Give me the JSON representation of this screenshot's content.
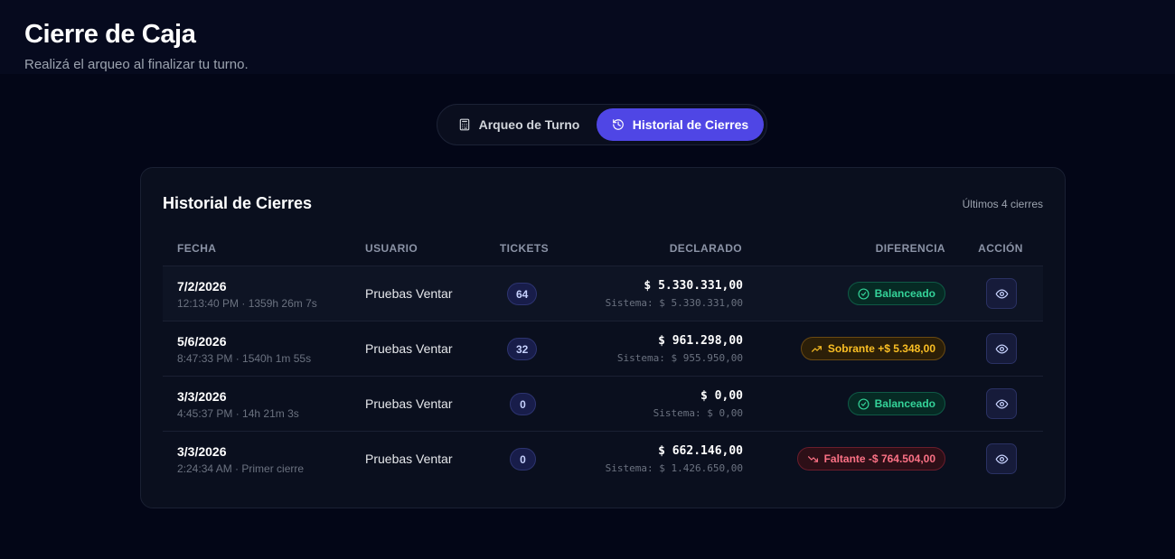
{
  "header": {
    "title": "Cierre de Caja",
    "subtitle": "Realizá el arqueo al finalizar tu turno."
  },
  "tabs": [
    {
      "label": "Arqueo de Turno",
      "icon": "calculator-icon",
      "active": false
    },
    {
      "label": "Historial de Cierres",
      "icon": "history-icon",
      "active": true
    }
  ],
  "card": {
    "title": "Historial de Cierres",
    "meta": "Últimos 4 cierres",
    "columns": {
      "fecha": "FECHA",
      "usuario": "USUARIO",
      "tickets": "TICKETS",
      "declarado": "DECLARADO",
      "diferencia": "DIFERENCIA",
      "accion": "ACCIÓN"
    },
    "rows": [
      {
        "date": "7/2/2026",
        "sub": "12:13:40 PM · 1359h 26m 7s",
        "user": "Pruebas Ventar",
        "tickets": "64",
        "declared": "$ 5.330.331,00",
        "system": "Sistema: $ 5.330.331,00",
        "diff": "Balanceado",
        "diff_type": "ok"
      },
      {
        "date": "5/6/2026",
        "sub": "8:47:33 PM · 1540h 1m 55s",
        "user": "Pruebas Ventar",
        "tickets": "32",
        "declared": "$ 961.298,00",
        "system": "Sistema: $ 955.950,00",
        "diff": "Sobrante +$ 5.348,00",
        "diff_type": "plus"
      },
      {
        "date": "3/3/2026",
        "sub": "4:45:37 PM · 14h 21m 3s",
        "user": "Pruebas Ventar",
        "tickets": "0",
        "declared": "$ 0,00",
        "system": "Sistema: $ 0,00",
        "diff": "Balanceado",
        "diff_type": "ok"
      },
      {
        "date": "3/3/2026",
        "sub": "2:24:34 AM · Primer cierre",
        "user": "Pruebas Ventar",
        "tickets": "0",
        "declared": "$ 662.146,00",
        "system": "Sistema: $ 1.426.650,00",
        "diff": "Faltante -$ 764.504,00",
        "diff_type": "minus"
      }
    ]
  },
  "colors": {
    "accent": "#4f46e5",
    "background": "#030617",
    "card": "#0a0f1e",
    "ok": "#34d399",
    "surplus": "#fbbf24",
    "shortage": "#fb7185"
  }
}
